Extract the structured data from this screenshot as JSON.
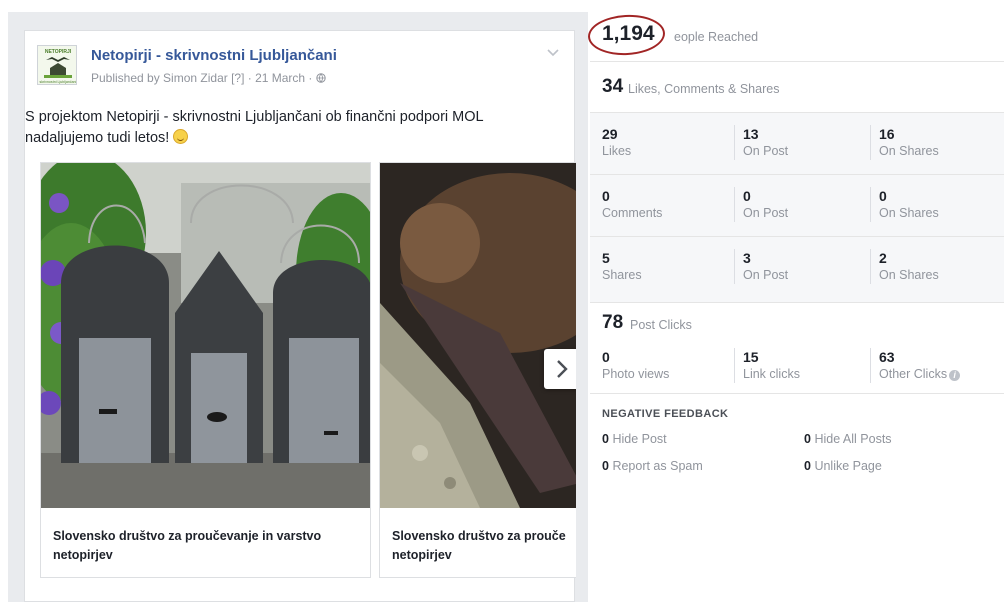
{
  "post": {
    "page_name": "Netopirji - skrivnostni Ljubljančani",
    "meta": "Published by Simon Zidar [?] · 21 March · ",
    "text_line1": "S projektom Netopirji - skrivnostni Ljubljančani ob finančni podpori MOL",
    "text_line2": "nadaljujemo tudi letos! ",
    "logo_text_top": "NETOPIRJI",
    "logo_text_bottom": "skrivnostni Ljubljančani",
    "carousel": [
      {
        "caption_line1": "Slovensko društvo za proučevanje in varstvo",
        "caption_line2": "netopirjev"
      },
      {
        "caption_line1": "Slovensko društvo za prouče",
        "caption_line2": "netopirjev"
      }
    ],
    "icons": [
      "chevron-down-icon",
      "globe-icon",
      "smiley-icon",
      "chevron-right-icon"
    ]
  },
  "insights": {
    "reach": {
      "value": "1,194",
      "label": "People Reached",
      "visible_label": "eople Reached"
    },
    "engagement": {
      "value": "34",
      "label": "Likes, Comments & Shares"
    },
    "grid": [
      {
        "total": "29",
        "total_label": "Likes",
        "on_post": "13",
        "on_post_label": "On Post",
        "on_shares": "16",
        "on_shares_label": "On Shares"
      },
      {
        "total": "0",
        "total_label": "Comments",
        "on_post": "0",
        "on_post_label": "On Post",
        "on_shares": "0",
        "on_shares_label": "On Shares"
      },
      {
        "total": "5",
        "total_label": "Shares",
        "on_post": "3",
        "on_post_label": "On Post",
        "on_shares": "2",
        "on_shares_label": "On Shares"
      }
    ],
    "post_clicks": {
      "value": "78",
      "label": "Post Clicks"
    },
    "clicks": [
      {
        "value": "0",
        "label": "Photo views"
      },
      {
        "value": "15",
        "label": "Link clicks"
      },
      {
        "value": "63",
        "label": "Other Clicks"
      }
    ],
    "negative": {
      "title": "NEGATIVE FEEDBACK",
      "items": [
        {
          "value": "0",
          "label": "Hide Post"
        },
        {
          "value": "0",
          "label": "Hide All Posts"
        },
        {
          "value": "0",
          "label": "Report as Spam"
        },
        {
          "value": "0",
          "label": "Unlike Page"
        }
      ]
    },
    "colors": {
      "link": "#365899",
      "muted": "#90949c",
      "highlight_circle": "#a12525"
    }
  }
}
